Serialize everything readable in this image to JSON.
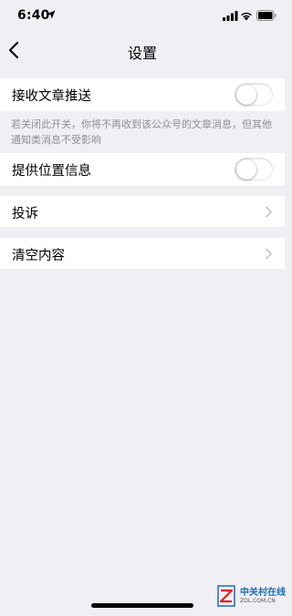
{
  "status_bar": {
    "time": "6:40",
    "icons": [
      "location-arrow-icon",
      "cellular-signal-icon",
      "wifi-icon",
      "battery-icon"
    ]
  },
  "nav": {
    "title": "设置",
    "back_icon": "chevron-left-icon"
  },
  "settings": {
    "receive_articles": {
      "label": "接收文章推送",
      "toggle_on": false
    },
    "receive_articles_note": "若关闭此开关，你将不再收到该公众号的文章消息，但其他通知类消息不受影响",
    "provide_location": {
      "label": "提供位置信息",
      "toggle_on": false
    },
    "complaint": {
      "label": "投诉",
      "icon": "chevron-right-icon"
    },
    "clear_content": {
      "label": "清空内容",
      "icon": "chevron-right-icon"
    }
  },
  "watermark": {
    "name": "中关村在线",
    "url": "ZOL.COM.CN"
  },
  "colors": {
    "background": "#efeff4",
    "cell": "#ffffff",
    "footnote": "#8e8e93",
    "toggle_off_border": "#e5e5ea",
    "chevron": "#c7c7cc"
  }
}
